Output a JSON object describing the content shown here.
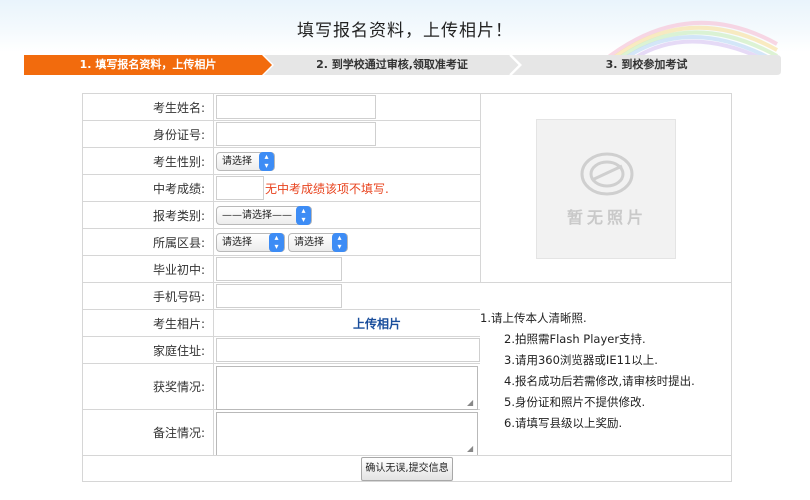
{
  "header": {
    "title": "填写报名资料，上传相片！"
  },
  "steps": [
    {
      "label": "1. 填写报名资料，上传相片",
      "active": true
    },
    {
      "label": "2. 到学校通过审核,领取准考证",
      "active": false
    },
    {
      "label": "3. 到校参加考试",
      "active": false
    }
  ],
  "colors": {
    "active_step": "#f26b0d",
    "inactive_step": "#e6e6e6",
    "note_red": "#e8431e",
    "link_blue": "#1a4e9c",
    "select_arrow": "#3d8cf5"
  },
  "form": {
    "name_label": "考生姓名:",
    "id_label": "身份证号:",
    "gender_label": "考生性别:",
    "gender_select": "请选择",
    "score_label": "中考成绩:",
    "score_note": "无中考成绩该项不填写.",
    "category_label": "报考类别:",
    "category_select": "——请选择——",
    "district_label": "所属区县:",
    "district_select_1": "请选择",
    "district_select_2": "请选择",
    "middle_school_label": "毕业初中:",
    "phone_label": "手机号码:",
    "photo_label": "考生相片:",
    "upload_link": "上传相片",
    "address_label": "家庭住址:",
    "awards_label": "获奖情况:",
    "remarks_label": "备注情况:",
    "submit_label": "确认无误,提交信息"
  },
  "photo_placeholder": {
    "text": "暂无照片",
    "icon": "camera-icon"
  },
  "tips": [
    "1.请上传本人清晰照.",
    "2.拍照需Flash Player支持.",
    "3.请用360浏览器或IE11以上.",
    "4.报名成功后若需修改,请审核时提出.",
    "5.身份证和照片不提供修改.",
    "6.请填写县级以上奖励."
  ]
}
